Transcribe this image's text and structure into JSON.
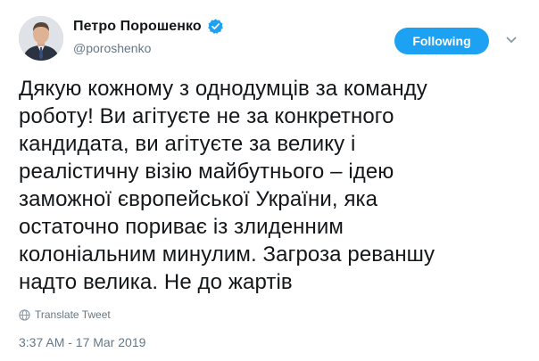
{
  "tweet": {
    "author": {
      "display_name": "Петро Порошенко",
      "handle": "@poroshenko",
      "verified": true
    },
    "follow_label": "Following",
    "text": "Дякую кожному з однодумців за команду\nроботу! Ви агітуєте не за конкретного\nкандидата, ви агітуєте за велику і\nреалістичну візію майбутнього – ідею\nзаможної європейської України, яка\nостаточно пориває із злиденним\nколоніальним минулим. Загроза реваншу\nнадто велика. Не до жартів",
    "translate_label": "Translate Tweet",
    "timestamp": "3:37 AM - 17 Mar 2019"
  },
  "colors": {
    "accent": "#1da1f2",
    "secondary_text": "#657786",
    "primary_text": "#14171a"
  },
  "icons": {
    "verified": "verified-badge-icon",
    "caret": "chevron-down-icon",
    "translate": "globe-icon"
  }
}
